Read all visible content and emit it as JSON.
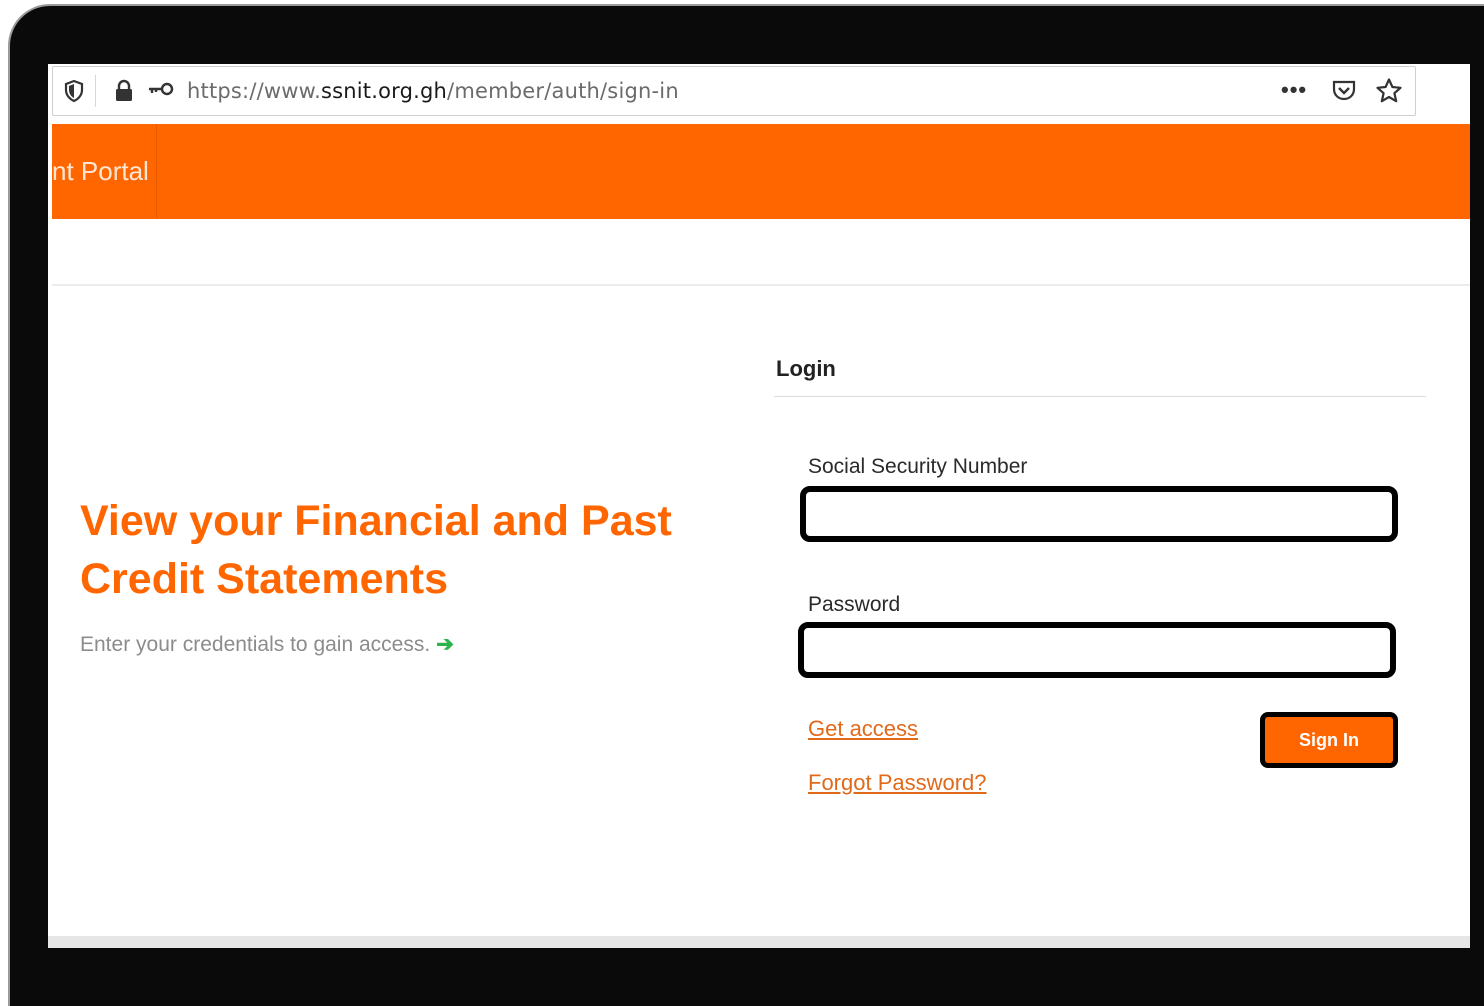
{
  "browser": {
    "url_prefix": "https://www.",
    "url_domain": "ssnit.org.gh",
    "url_path": "/member/auth/sign-in",
    "overflow_label": "•••",
    "icons": [
      "shield-icon",
      "lock-icon",
      "key-icon",
      "more-icon",
      "pocket-icon",
      "bookmark-star-icon"
    ]
  },
  "header": {
    "brand": "nt Portal",
    "accent_color": "#ff6600"
  },
  "hero": {
    "title": "View your Financial and Past Credit Statements",
    "subtitle": "Enter your credentials to gain access.",
    "arrow_icon": "arrow-right-icon",
    "arrow_color": "#2db34a"
  },
  "login": {
    "heading": "Login",
    "ssn_label": "Social Security Number",
    "ssn_value": "",
    "password_label": "Password",
    "password_value": "",
    "get_access": "Get access",
    "forgot_password": "Forgot Password?",
    "sign_in": "Sign In"
  }
}
